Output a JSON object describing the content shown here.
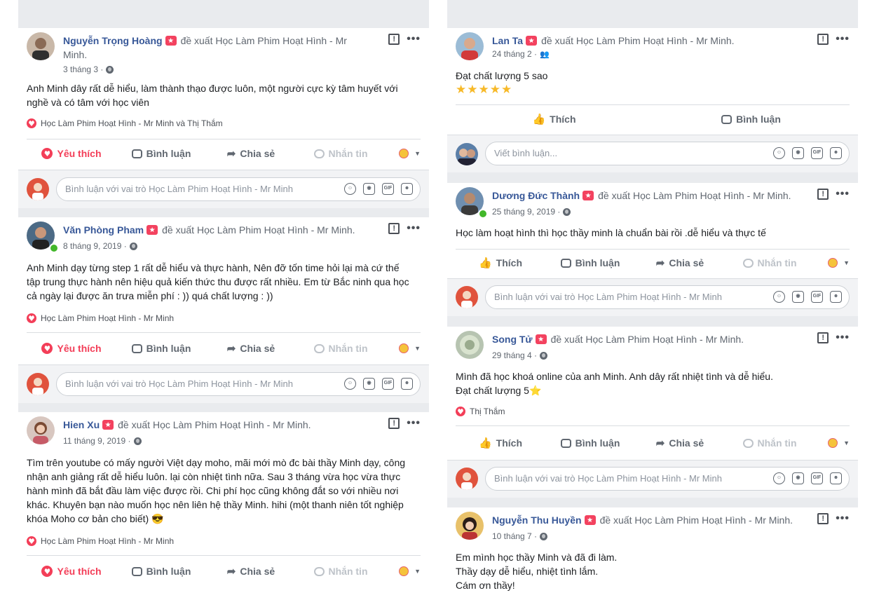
{
  "common": {
    "recommends": "đề xuất",
    "love": "Yêu thích",
    "like": "Thích",
    "comment": "Bình luận",
    "share": "Chia sẻ",
    "message": "Nhắn tin",
    "comment_as_page": "Bình luận với vai trò Học Làm Phim Hoạt Hình - Mr Minh",
    "write_comment": "Viết bình luận..."
  },
  "left": {
    "p1": {
      "name": "Nguyễn Trọng Hoàng",
      "page": "Học Làm Phim Hoạt Hình - Mr Minh.",
      "time": "3 tháng 3 ·",
      "text": "Anh Minh dây rất dễ hiểu, làm thành thạo được luôn, một người cực kỳ tâm huyết với nghề và có tâm với học viên",
      "reactions": "Học Làm Phim Hoạt Hình - Mr Minh và Thị Thắm"
    },
    "p2": {
      "name": "Văn Phòng Pham",
      "page": "Học Làm Phim Hoạt Hình - Mr Minh.",
      "time": "8 tháng 9, 2019 ·",
      "text": "Anh Minh dạy từng step 1 rất dễ hiểu và thực hành, Nên đỡ tốn time hỏi lại mà cứ thế tập trung thực hành nên hiệu quả kiến thức thu được rất nhiều. Em từ Bắc ninh qua học cả ngày lại được ăn trưa miễn phí : )) quá chất lượng : ))",
      "reactions": "Học Làm Phim Hoạt Hình - Mr Minh"
    },
    "p3": {
      "name": "Hien Xu",
      "page": "Học Làm Phim Hoạt Hình - Mr Minh.",
      "time": "11 tháng 9, 2019 ·",
      "text": "Tìm trên youtube có mấy người Việt dạy moho, mãi mới mò đc bài thầy Minh dạy, công nhận anh giảng rất dễ hiểu luôn. lại còn nhiệt tình nữa. Sau 3 tháng vừa học vừa thực hành mình đã bắt đầu làm việc được rồi. Chi phí học cũng không đắt so với nhiều nơi khác. Khuyên bạn nào muốn học nên liên hệ thầy Minh. hihi (một thanh niên tốt nghiệp khóa Moho cơ bản cho biết) 😎",
      "reactions": "Học Làm Phim Hoạt Hình - Mr Minh"
    }
  },
  "right": {
    "p1": {
      "name": "Lan Ta",
      "page": "Học Làm Phim Hoạt Hình - Mr Minh.",
      "time": "24 tháng 2 ·",
      "text": "Đạt chất lượng 5 sao",
      "stars": "★★★★★"
    },
    "p2": {
      "name": "Dương Đức Thành",
      "page": "Học Làm Phim Hoạt Hình - Mr Minh.",
      "time": "25 tháng 9, 2019 ·",
      "text": "Học làm hoạt hình thì học thầy minh là chuẩn bài rồi .dễ hiểu và thực tế"
    },
    "p3": {
      "name": "Song Tử",
      "page": "Học Làm Phim Hoạt Hình - Mr Minh.",
      "time": "29 tháng 4 ·",
      "text1": "Mình đã học khoá online của anh Minh. Anh dây rất nhiệt tình và dễ hiểu.",
      "text2": "Đạt chất lượng 5⭐",
      "reactions": "Thị Thắm"
    },
    "p4": {
      "name": "Nguyễn Thu Huyền",
      "page": "Học Làm Phim Hoạt Hình - Mr Minh.",
      "time": "10 tháng 7 ·",
      "text1": "Em mình học thầy Minh và đã đi làm.",
      "text2": "Thầy dạy dễ hiểu, nhiệt tình lắm.",
      "text3": "Cám ơn thầy!"
    }
  }
}
